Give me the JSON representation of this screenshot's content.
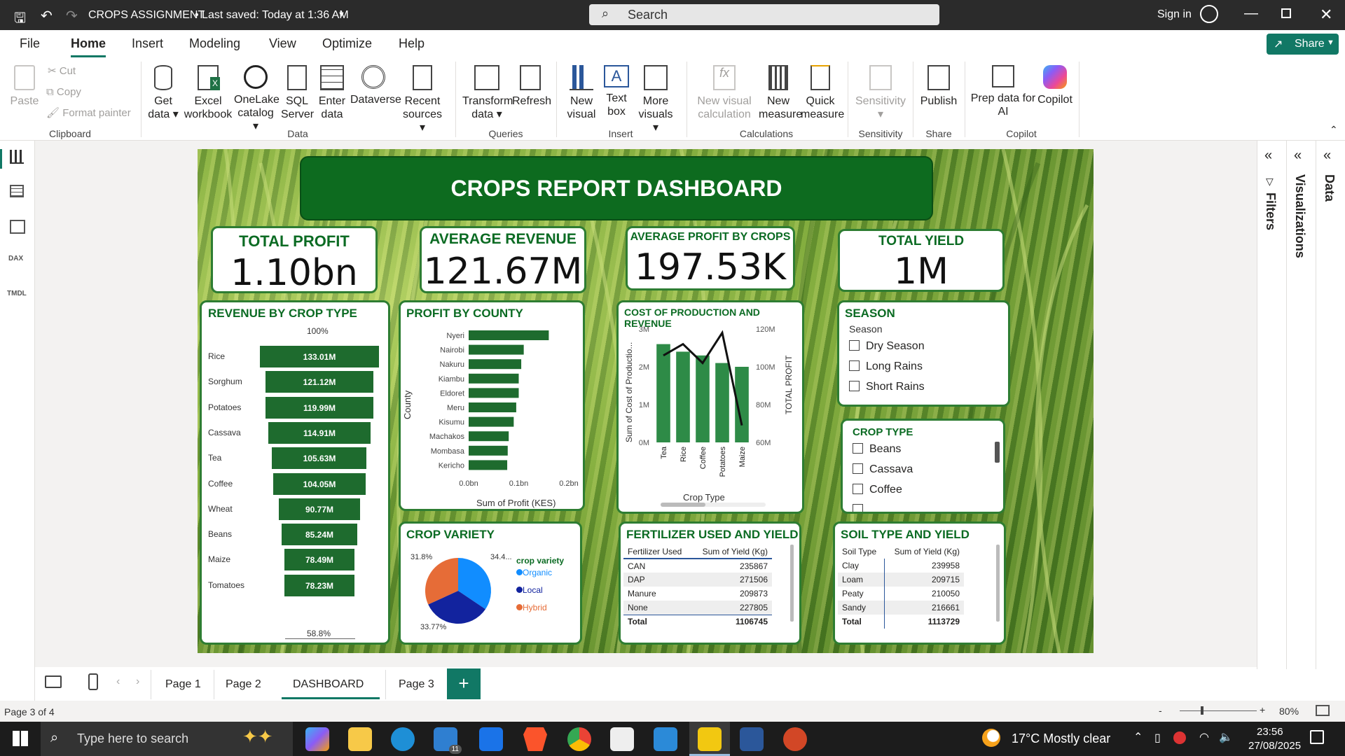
{
  "titlebar": {
    "title": "CROPS ASSIGNMENT",
    "saved": "• Last saved: Today at 1:36 AM",
    "search": "Search",
    "signin": "Sign in"
  },
  "menu": {
    "file": "File",
    "home": "Home",
    "insert": "Insert",
    "modeling": "Modeling",
    "view": "View",
    "optimize": "Optimize",
    "help": "Help",
    "share": "Share"
  },
  "ribbon": {
    "clipboard": {
      "paste": "Paste",
      "cut": "Cut",
      "copy": "Copy",
      "format": "Format painter",
      "group": "Clipboard"
    },
    "data": {
      "getdata": "Get data",
      "excel": "Excel workbook",
      "onelake": "OneLake catalog",
      "sql": "SQL Server",
      "enter": "Enter data",
      "dataverse": "Dataverse",
      "recent": "Recent sources",
      "group": "Data"
    },
    "queries": {
      "transform": "Transform data",
      "refresh": "Refresh",
      "group": "Queries"
    },
    "insert": {
      "newvisual": "New visual",
      "textbox": "Text box",
      "more": "More visuals",
      "group": "Insert"
    },
    "calc": {
      "newvisualcalc": "New visual calculation",
      "newmeasure": "New measure",
      "quick": "Quick measure",
      "group": "Calculations"
    },
    "sensitivity": {
      "label": "Sensitivity",
      "group": "Sensitivity"
    },
    "share": {
      "publish": "Publish",
      "group": "Share"
    },
    "copilot": {
      "prep": "Prep data for AI",
      "copilot": "Copilot",
      "group": "Copilot"
    }
  },
  "report": {
    "title": "CROPS REPORT DASHBOARD",
    "kpis": {
      "profit": {
        "label": "TOTAL PROFIT",
        "value": "1.10bn"
      },
      "revenue": {
        "label": "AVERAGE REVENUE",
        "value": "121.67M"
      },
      "avgprofit": {
        "label": "AVERAGE PROFIT BY CROPS",
        "value": "197.53K"
      },
      "yield": {
        "label": "TOTAL YIELD",
        "value": "1M"
      }
    },
    "revenue_by_crop": {
      "title": "REVENUE BY CROP TYPE",
      "top": "100%",
      "bottom": "58.8%",
      "rows": [
        {
          "cat": "Rice",
          "label": "133.01M",
          "value": 133.01
        },
        {
          "cat": "Sorghum",
          "label": "121.12M",
          "value": 121.12
        },
        {
          "cat": "Potatoes",
          "label": "119.99M",
          "value": 119.99
        },
        {
          "cat": "Cassava",
          "label": "114.91M",
          "value": 114.91
        },
        {
          "cat": "Tea",
          "label": "105.63M",
          "value": 105.63
        },
        {
          "cat": "Coffee",
          "label": "104.05M",
          "value": 104.05
        },
        {
          "cat": "Wheat",
          "label": "90.77M",
          "value": 90.77
        },
        {
          "cat": "Beans",
          "label": "85.24M",
          "value": 85.24
        },
        {
          "cat": "Maize",
          "label": "78.49M",
          "value": 78.49
        },
        {
          "cat": "Tomatoes",
          "label": "78.23M",
          "value": 78.23
        }
      ]
    },
    "profit_by_county": {
      "title": "PROFIT BY COUNTY",
      "ylabel": "County",
      "xlabel": "Sum of Profit (KES)",
      "ticks": [
        "0.0bn",
        "0.1bn",
        "0.2bn"
      ]
    },
    "cost_revenue": {
      "title": "COST OF PRODUCTION AND REVENUE",
      "ylabel": "Sum of Cost of Productio...",
      "y2label": "TOTAL PROFIT",
      "xlabel": "Crop Type",
      "yticks": [
        "3M",
        "2M",
        "1M",
        "0M"
      ],
      "y2ticks": [
        "120M",
        "100M",
        "80M",
        "60M"
      ]
    },
    "season": {
      "title": "SEASON",
      "sub": "Season",
      "items": [
        "Dry Season",
        "Long Rains",
        "Short Rains"
      ]
    },
    "croptype": {
      "title": "CROP TYPE",
      "items": [
        "Beans",
        "Cassava",
        "Coffee"
      ]
    },
    "variety": {
      "title": "CROP VARIETY",
      "legend_title": "crop variety",
      "labels": [
        "31.8%",
        "34.4...",
        "33.77%"
      ],
      "legend": [
        "Organic",
        "Local",
        "Hybrid"
      ]
    },
    "fertilizer": {
      "title": "FERTILIZER USED AND YIELD",
      "cols": [
        "Fertilizer Used",
        "Sum of Yield (Kg)"
      ],
      "rows": [
        [
          "CAN",
          "235867"
        ],
        [
          "DAP",
          "271506"
        ],
        [
          "Manure",
          "209873"
        ],
        [
          "None",
          "227805"
        ]
      ],
      "total": [
        "Total",
        "1106745"
      ]
    },
    "soil": {
      "title": "SOIL TYPE AND YIELD",
      "cols": [
        "Soil Type",
        "Sum of Yield (Kg)"
      ],
      "rows": [
        [
          "Clay",
          "239958"
        ],
        [
          "Loam",
          "209715"
        ],
        [
          "Peaty",
          "210050"
        ],
        [
          "Sandy",
          "216661"
        ]
      ],
      "total": [
        "Total",
        "1113729"
      ]
    }
  },
  "chart_data": [
    {
      "type": "bar",
      "title": "PROFIT BY COUNTY",
      "xlabel": "Sum of Profit (KES)",
      "ylabel": "County",
      "xlim": [
        0,
        0.2
      ],
      "categories": [
        "Nyeri",
        "Nairobi",
        "Nakuru",
        "Kiambu",
        "Eldoret",
        "Meru",
        "Kisumu",
        "Machakos",
        "Mombasa",
        "Kericho"
      ],
      "values": [
        0.16,
        0.11,
        0.105,
        0.1,
        0.1,
        0.095,
        0.09,
        0.08,
        0.078,
        0.077
      ]
    },
    {
      "type": "bar",
      "title": "COST OF PRODUCTION AND REVENUE",
      "xlabel": "Crop Type",
      "ylabel": "Sum of Cost of Productio...",
      "ylim": [
        0,
        3
      ],
      "categories": [
        "Tea",
        "Rice",
        "Coffee",
        "Potatoes",
        "Maize"
      ],
      "series": [
        {
          "name": "Sum of Cost of Productio...",
          "values": [
            2.6,
            2.4,
            2.3,
            2.1,
            2.0
          ]
        },
        {
          "name": "TOTAL PROFIT",
          "values": [
            106,
            112,
            102,
            118,
            69
          ]
        }
      ]
    },
    {
      "type": "pie",
      "title": "CROP VARIETY",
      "categories": [
        "Organic",
        "Local",
        "Hybrid"
      ],
      "values": [
        34.4,
        33.77,
        31.8
      ],
      "colors": [
        "#118dff",
        "#12239e",
        "#e66c37"
      ]
    }
  ],
  "tabs": {
    "p1": "Page 1",
    "p2": "Page 2",
    "dash": "DASHBOARD",
    "p3": "Page 3",
    "status": "Page 3 of 4",
    "zoom": "80%"
  },
  "taskbar": {
    "search": "Type here to search",
    "weather": "17°C  Mostly clear",
    "time": "23:56",
    "date": "27/08/2025",
    "badge": "11"
  }
}
